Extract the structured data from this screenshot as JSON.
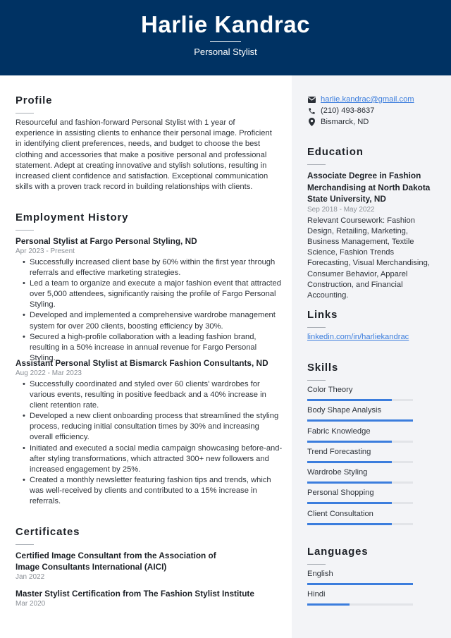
{
  "header": {
    "name": "Harlie Kandrac",
    "title": "Personal Stylist"
  },
  "profile": {
    "heading": "Profile",
    "text": "Resourceful and fashion-forward Personal Stylist with 1 year of experience in assisting clients to enhance their personal image. Proficient in identifying client preferences, needs, and budget to choose the best clothing and accessories that make a positive personal and professional statement. Adept at creating innovative and stylish solutions, resulting in increased client confidence and satisfaction. Exceptional communication skills with a proven track record in building relationships with clients."
  },
  "employment": {
    "heading": "Employment History",
    "jobs": [
      {
        "title": "Personal Stylist at Fargo Personal Styling, ND",
        "dates": "Apr 2023 - Present",
        "bullets": [
          "Successfully increased client base by 60% within the first year through referrals and effective marketing strategies.",
          "Led a team to organize and execute a major fashion event that attracted over 5,000 attendees, significantly raising the profile of Fargo Personal Styling.",
          "Developed and implemented a comprehensive wardrobe management system for over 200 clients, boosting efficiency by 30%.",
          "Secured a high-profile collaboration with a leading fashion brand, resulting in a 50% increase in annual revenue for Fargo Personal Styling."
        ]
      },
      {
        "title": "Assistant Personal Stylist at Bismarck Fashion Consultants, ND",
        "dates": "Aug 2022 - Mar 2023",
        "bullets": [
          "Successfully coordinated and styled over 60 clients' wardrobes for various events, resulting in positive feedback and a 40% increase in client retention rate.",
          "Developed a new client onboarding process that streamlined the styling process, reducing initial consultation times by 30% and increasing overall efficiency.",
          "Initiated and executed a social media campaign showcasing before-and-after styling transformations, which attracted 300+ new followers and increased engagement by 25%.",
          "Created a monthly newsletter featuring fashion tips and trends, which was well-received by clients and contributed to a 15% increase in referrals."
        ]
      }
    ]
  },
  "certificates": {
    "heading": "Certificates",
    "items": [
      {
        "title": "Certified Image Consultant from the Association of Image Consultants International (AICI)",
        "date": "Jan 2022"
      },
      {
        "title": "Master Stylist Certification from The Fashion Stylist Institute",
        "date": "Mar 2020"
      }
    ]
  },
  "contact": {
    "email": "harlie.kandrac@gmail.com",
    "phone": "(210) 493-8637",
    "location": "Bismarck, ND"
  },
  "education": {
    "heading": "Education",
    "degree": "Associate Degree in Fashion Merchandising at North Dakota State University, ND",
    "dates": "Sep 2018 - May 2022",
    "description": "Relevant Coursework: Fashion Design, Retailing, Marketing, Business Management, Textile Science, Fashion Trends Forecasting, Visual Merchandising, Consumer Behavior, Apparel Construction, and Financial Accounting."
  },
  "links": {
    "heading": "Links",
    "items": [
      "linkedin.com/in/harliekandrac"
    ]
  },
  "skills": {
    "heading": "Skills",
    "items": [
      {
        "name": "Color Theory",
        "level": 0.8
      },
      {
        "name": "Body Shape Analysis",
        "level": 1.0
      },
      {
        "name": "Fabric Knowledge",
        "level": 0.8
      },
      {
        "name": "Trend Forecasting",
        "level": 0.8
      },
      {
        "name": "Wardrobe Styling",
        "level": 0.8
      },
      {
        "name": "Personal Shopping",
        "level": 0.8
      },
      {
        "name": "Client Consultation",
        "level": 0.8
      }
    ]
  },
  "languages": {
    "heading": "Languages",
    "items": [
      {
        "name": "English",
        "level": 1.0
      },
      {
        "name": "Hindi",
        "level": 0.4
      }
    ]
  },
  "colors": {
    "header_bg": "#003263",
    "accent": "#3b7ddd",
    "sidebar_bg": "#f3f4f7"
  }
}
